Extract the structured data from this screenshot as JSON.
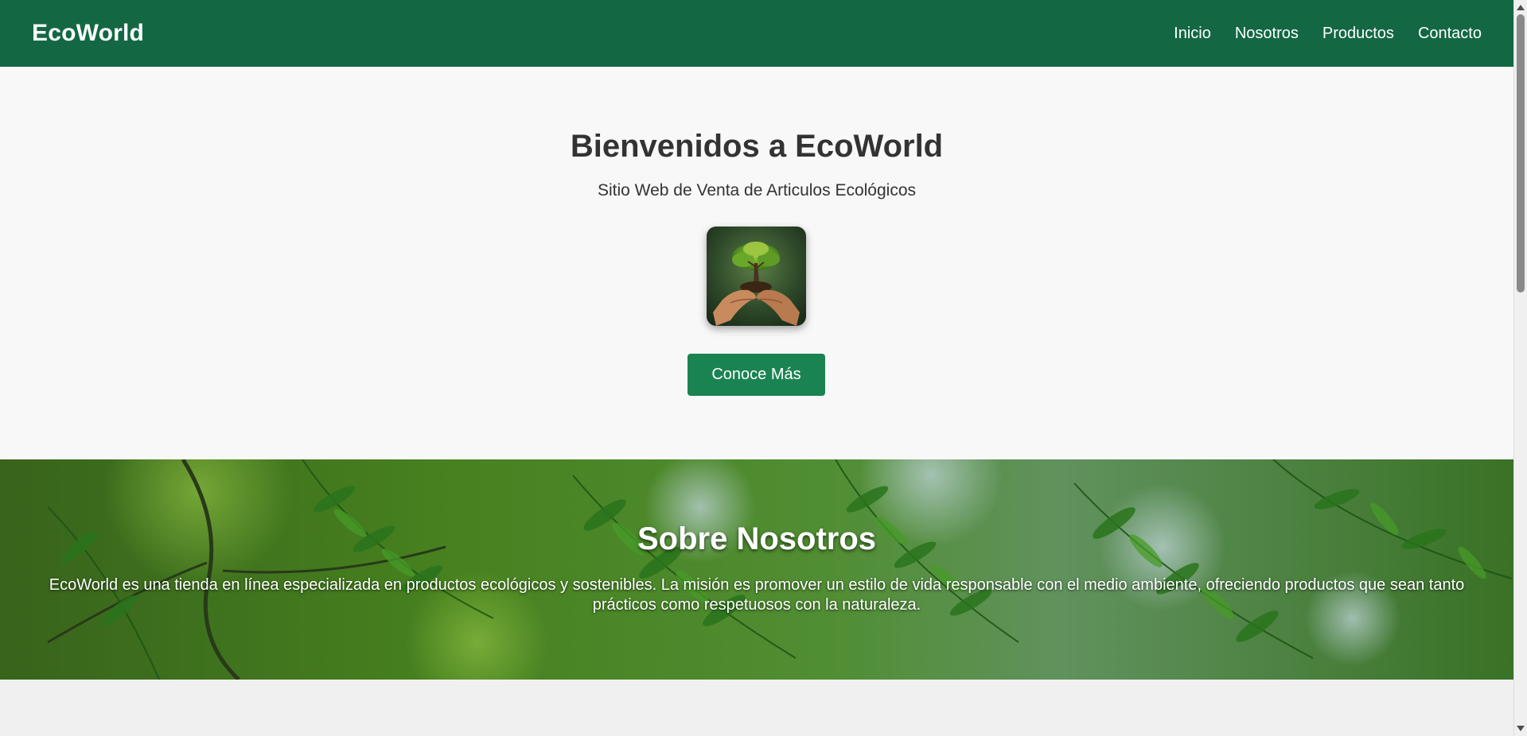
{
  "header": {
    "brand": "EcoWorld",
    "nav": [
      "Inicio",
      "Nosotros",
      "Productos",
      "Contacto"
    ]
  },
  "hero": {
    "title": "Bienvenidos a EcoWorld",
    "subtitle": "Sitio Web de Venta de Articulos Ecológicos",
    "image_icon": "tree-in-hands-image",
    "button_label": "Conoce Más"
  },
  "about": {
    "title": "Sobre Nosotros",
    "text": "EcoWorld es una tienda en línea especializada en productos ecológicos y sostenibles. La misión es promover un estilo de vida responsable con el medio ambiente, ofreciendo productos que sean tanto prácticos como respetuosos con la naturaleza.",
    "background_icon": "fern-leaves-background"
  },
  "colors": {
    "header_bg": "#136843",
    "button_bg": "#1a8352",
    "hero_bg": "#f8f8f8",
    "text_dark": "#333333"
  }
}
